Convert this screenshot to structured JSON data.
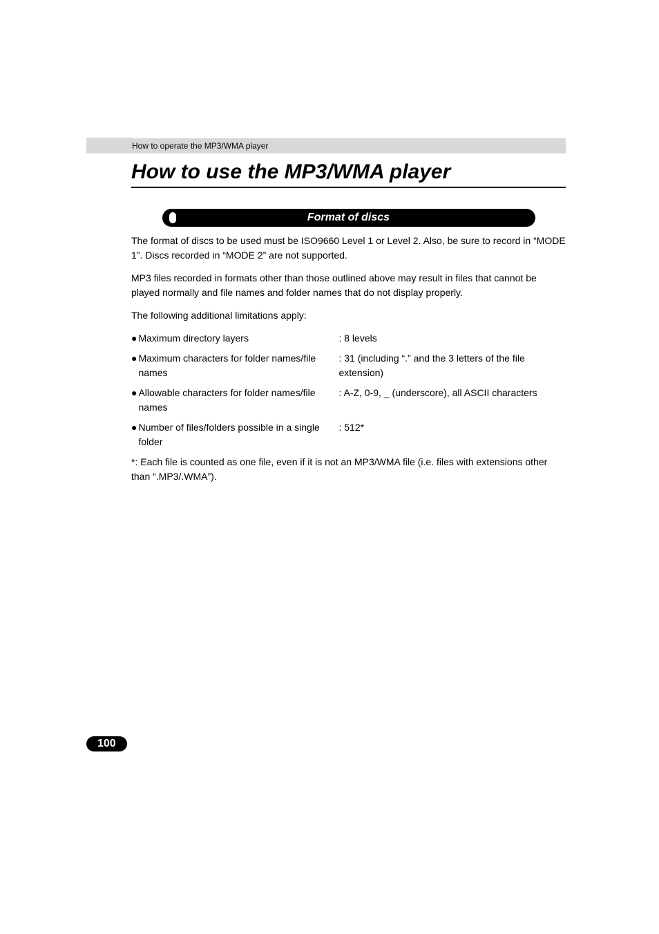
{
  "breadcrumb": "How to operate the MP3/WMA player",
  "title": "How to use the MP3/WMA player",
  "section_heading": "Format of discs",
  "para1": "The format of discs to be used must be ISO9660 Level 1 or Level 2. Also, be sure to record in “MODE 1”. Discs recorded in “MODE 2” are not supported.",
  "para2": "MP3 files recorded in formats other than those outlined above may result in files that cannot be played normally and file names and folder names that do not display properly.",
  "para3": "The following additional limitations apply:",
  "bullets": [
    {
      "label": "Maximum directory layers",
      "value": ": 8 levels"
    },
    {
      "label": "Maximum characters for folder names/file names",
      "value": ": 31 (including “.” and the 3 letters of the file extension)"
    },
    {
      "label": "Allowable characters for folder names/file names",
      "value": ": A-Z, 0-9, _ (underscore), all ASCII characters"
    },
    {
      "label": "Number of files/folders possible in a single folder",
      "value": ": 512*"
    }
  ],
  "footnote": "*: Each file is counted as one file, even if it is not an MP3/WMA file (i.e. files with extensions other than “.MP3/.WMA”).",
  "page_number": "100"
}
